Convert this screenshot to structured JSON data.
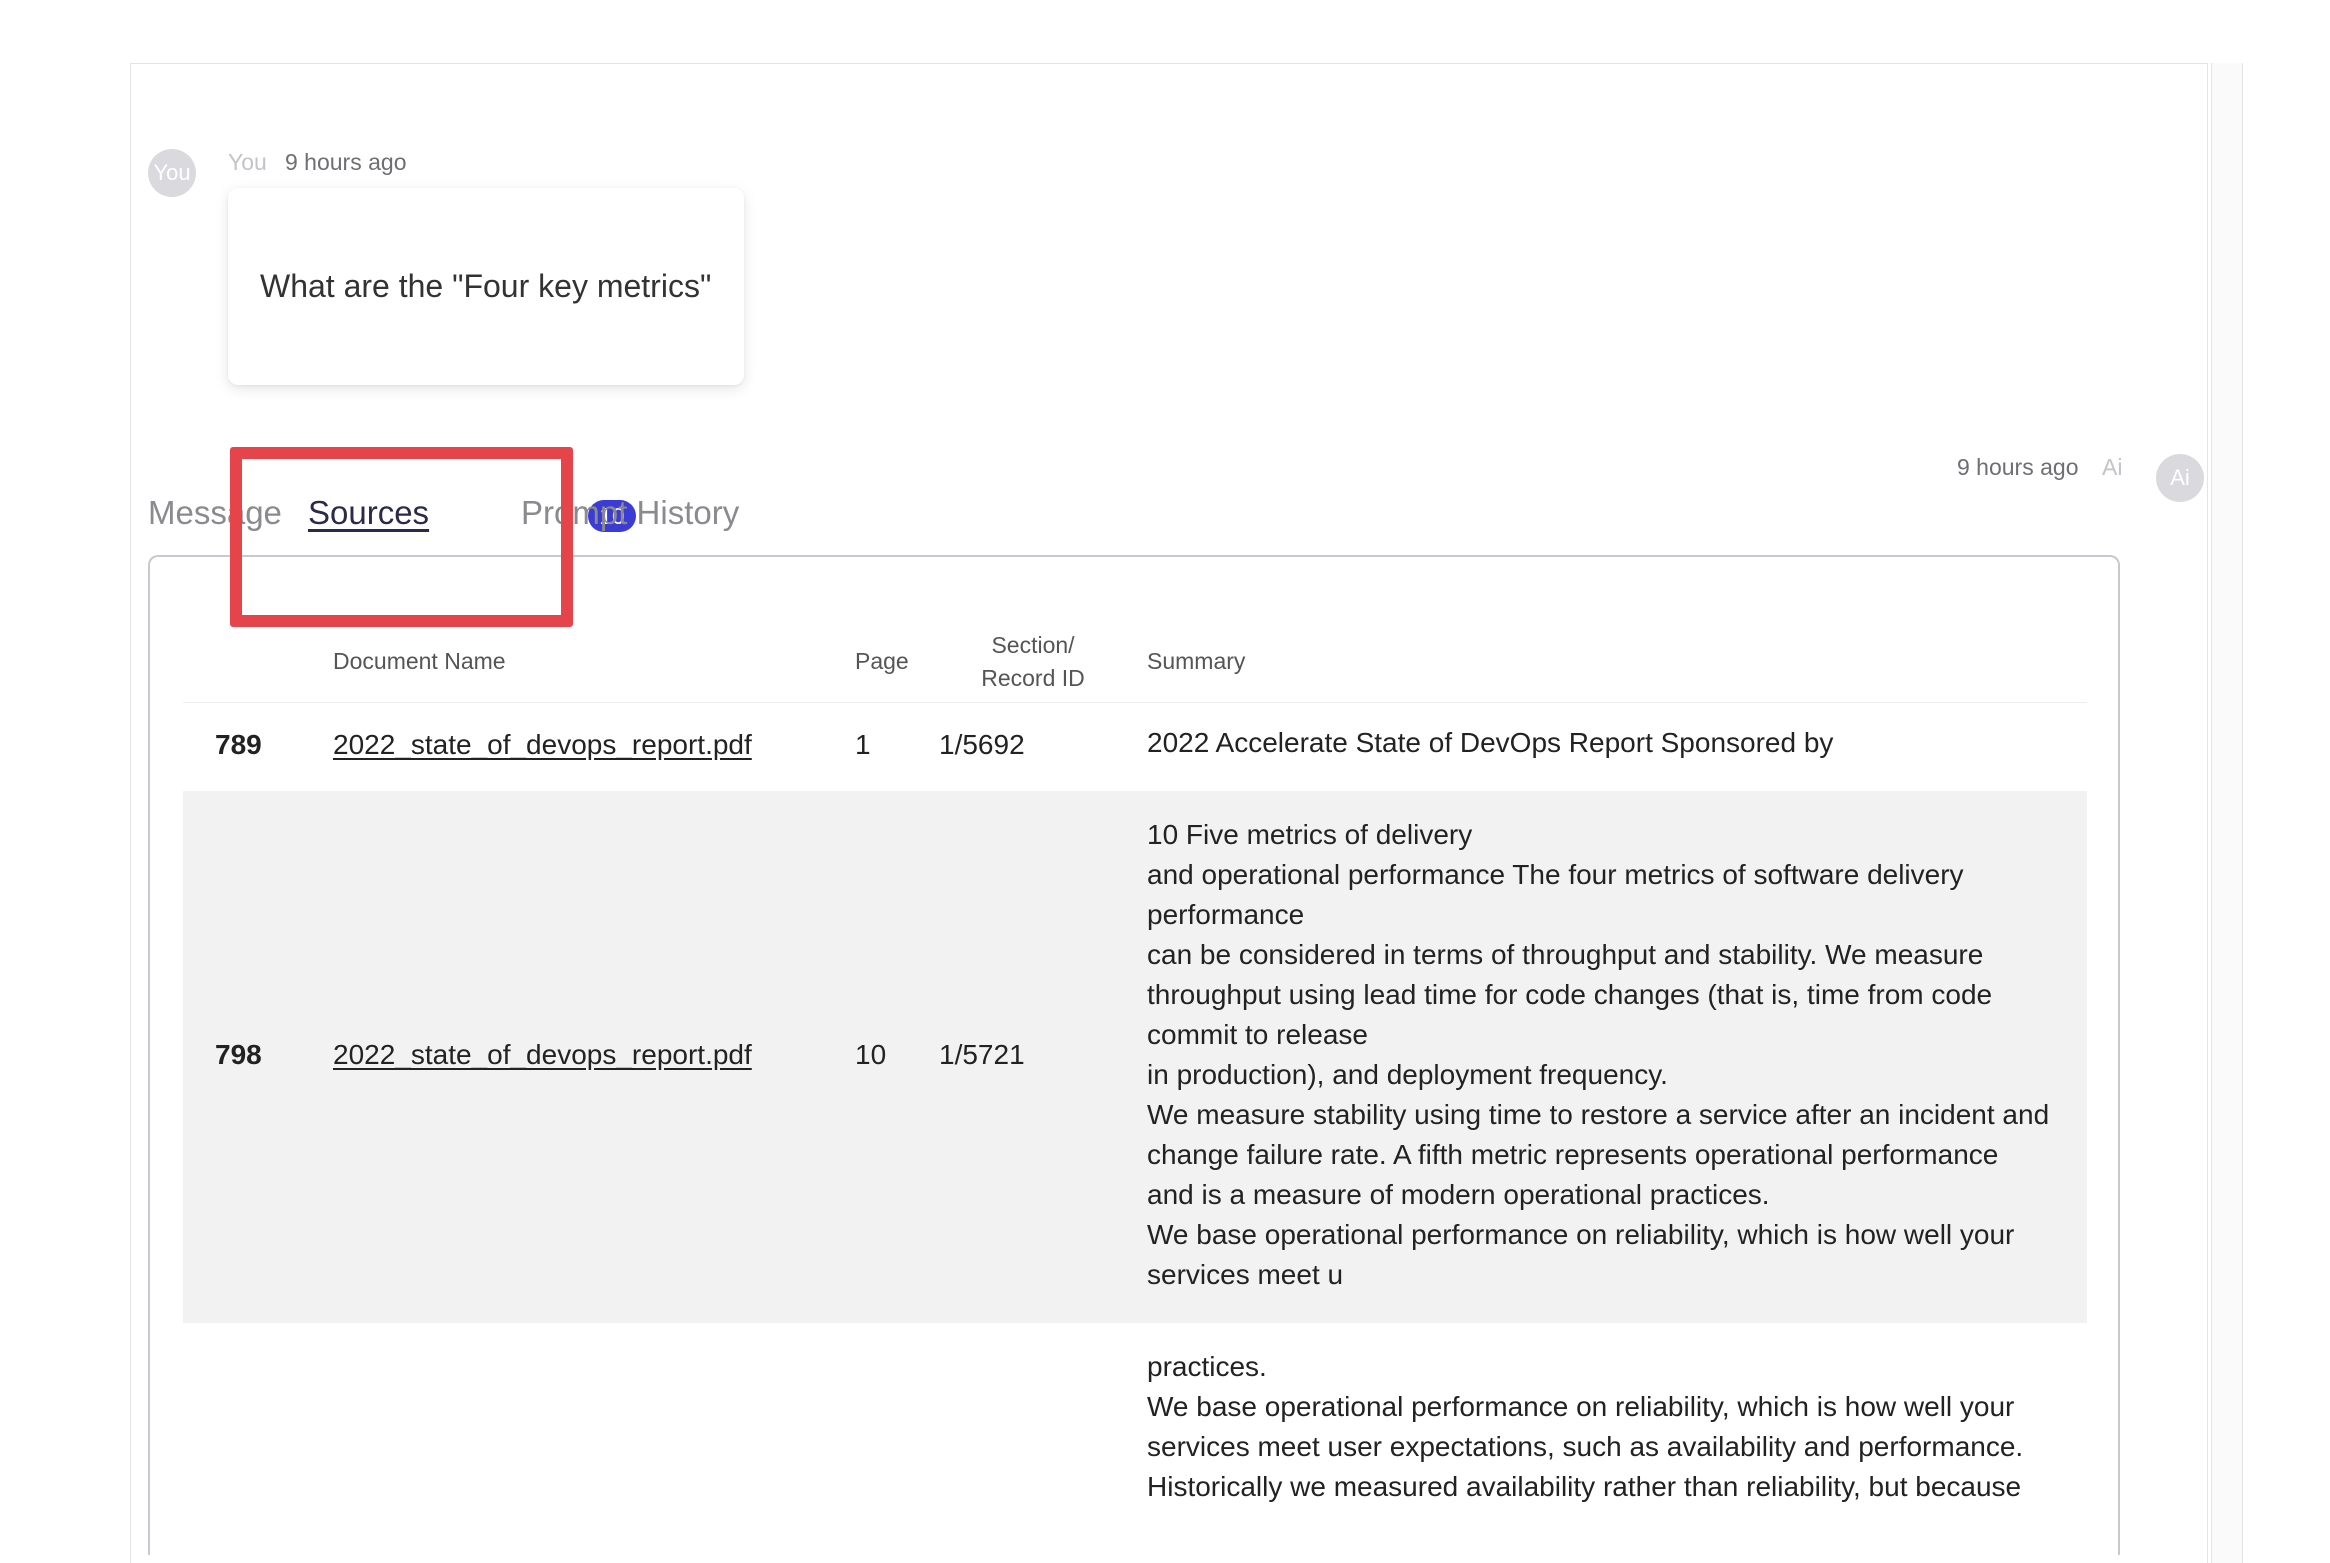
{
  "user_message": {
    "avatar": "You",
    "author": "You",
    "time": "9 hours ago",
    "text": "What are the \"Four key metrics\""
  },
  "ai_message": {
    "avatar": "Ai",
    "author": "Ai",
    "time": "9 hours ago"
  },
  "tabs": {
    "message": "Message",
    "sources": "Sources",
    "sources_count": "10",
    "prompt_history": "Prompt History"
  },
  "table": {
    "headers": {
      "document_name": "Document Name",
      "page": "Page",
      "section_line1": "Section/",
      "section_line2": "Record ID",
      "summary": "Summary"
    },
    "rows": [
      {
        "num": "789",
        "document": "2022_state_of_devops_report.pdf",
        "page": "1",
        "section": "1/5692",
        "summary": [
          "2022 Accelerate State of DevOps Report Sponsored by"
        ]
      },
      {
        "num": "798",
        "document": "2022_state_of_devops_report.pdf",
        "page": "10",
        "section": "1/5721",
        "summary": [
          "10 Five metrics of delivery",
          "and operational performance The four metrics of software delivery",
          "performance",
          "can be considered in terms of throughput and stability. We measure",
          "throughput using lead time for code changes (that is, time from code",
          "commit to release",
          "in production), and deployment frequency.",
          "We measure stability using time to restore a service after an incident and",
          "change failure rate. A fifth metric represents operational performance",
          "and is a measure of modern operational practices.",
          "We base operational performance on reliability, which is how well your",
          "services meet u"
        ]
      },
      {
        "summary": [
          "practices.",
          "We base operational performance on reliability, which is how well your",
          "services meet user expectations, such as availability and performance.",
          "Historically we measured availability rather than reliability, but because"
        ]
      }
    ]
  },
  "colors": {
    "highlight": "#e5444a",
    "badge": "#3b3bd6",
    "row_alt": "#f2f2f2"
  }
}
